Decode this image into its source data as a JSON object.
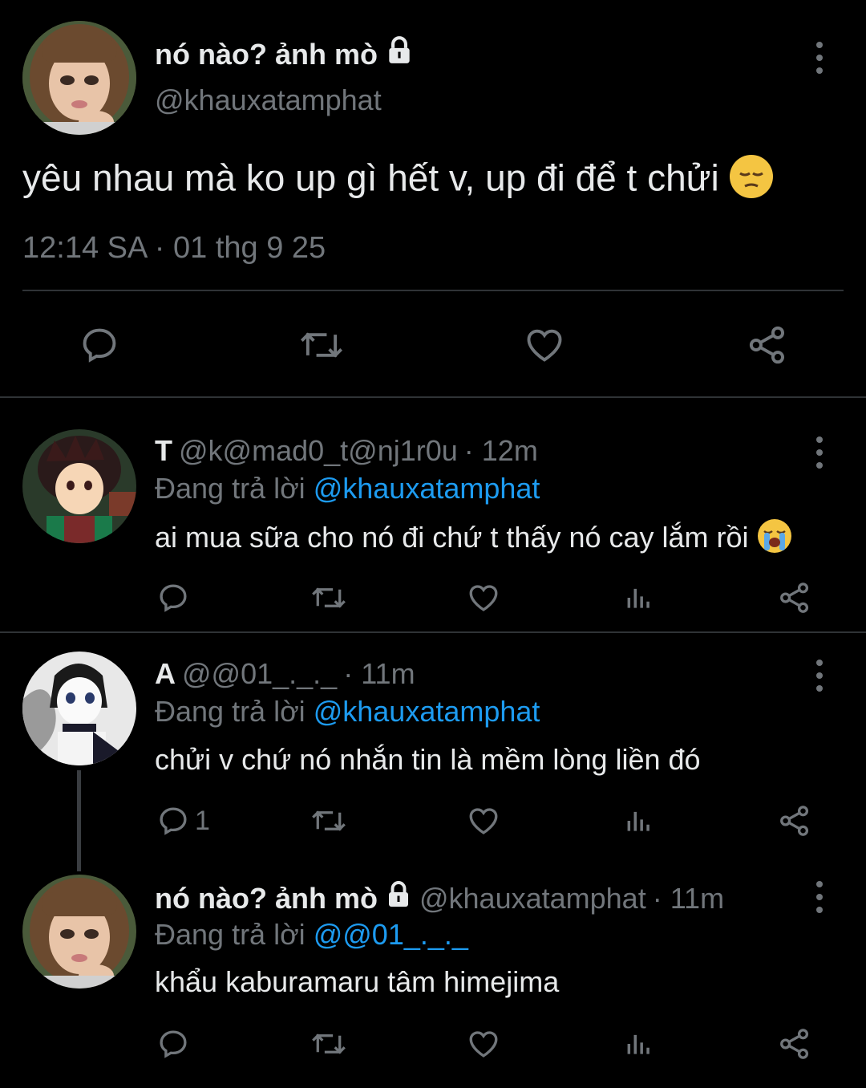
{
  "main_tweet": {
    "display_name": "nó nào? ảnh mò",
    "handle": "@khauxatamphat",
    "text": "yêu nhau mà ko up gì hết v, up đi để t chửi",
    "timestamp": "12:14 SA · 01 thg 9 25",
    "emoji": "pensive-face",
    "protected_icon": "lock-icon"
  },
  "replies": [
    {
      "display_name": "T",
      "handle": "@k@mad0_t@nj1r0u",
      "time": "· 12m",
      "replying_prefix": "Đang trả lời",
      "replying_to": "@khauxatamphat",
      "text": "ai mua sữa cho nó đi chứ t thấy nó cay lắm rồi",
      "emoji": "loudly-crying-face",
      "reply_count": ""
    },
    {
      "display_name": "A",
      "handle": "@@01_._._",
      "time": "· 11m",
      "replying_prefix": "Đang trả lời",
      "replying_to": "@khauxatamphat",
      "text": "chửi v chứ nó nhắn tin là mềm lòng liền đó",
      "reply_count": "1"
    },
    {
      "display_name": "nó nào? ảnh mò",
      "handle": "@khauxatamphat",
      "time": "· 11m",
      "replying_prefix": "Đang trả lời",
      "replying_to": "@@01_._._",
      "text": "khẩu kaburamaru tâm himejima",
      "reply_count": ""
    }
  ],
  "colors": {
    "background": "#000000",
    "text_primary": "#e7e9ea",
    "text_secondary": "#71767b",
    "link": "#1d9bf0",
    "divider": "#2f3336"
  }
}
